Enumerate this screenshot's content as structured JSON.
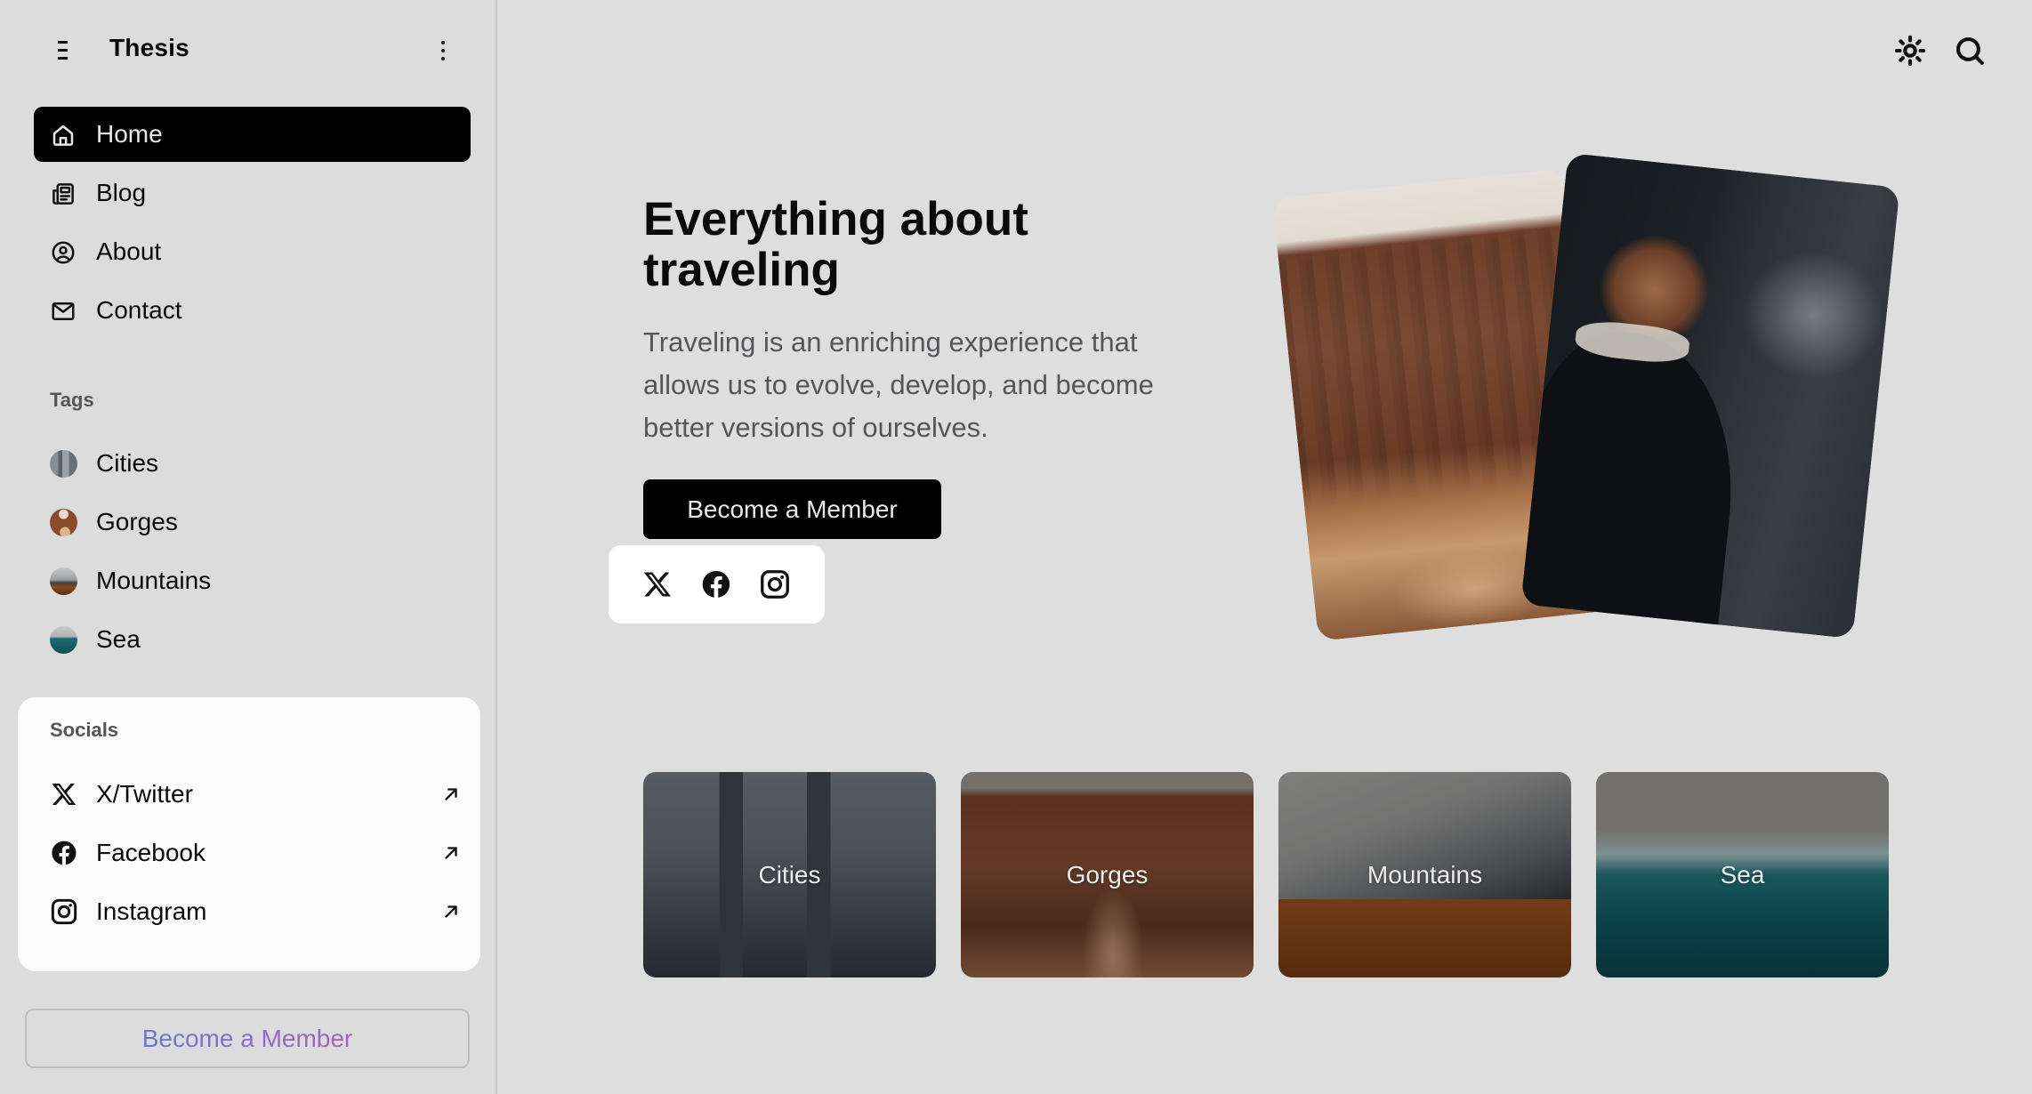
{
  "app": {
    "title": "Thesis",
    "menu_icon": "hamburger-icon",
    "more_icon": "kebab-menu-icon"
  },
  "sidebar": {
    "nav": [
      {
        "label": "Home",
        "icon": "home-icon",
        "active": true
      },
      {
        "label": "Blog",
        "icon": "newspaper-icon",
        "active": false
      },
      {
        "label": "About",
        "icon": "user-circle-icon",
        "active": false
      },
      {
        "label": "Contact",
        "icon": "mail-icon",
        "active": false
      }
    ],
    "tags_label": "Tags",
    "tags": [
      {
        "label": "Cities",
        "thumb": "cities-thumbnail"
      },
      {
        "label": "Gorges",
        "thumb": "gorges-thumbnail"
      },
      {
        "label": "Mountains",
        "thumb": "mountains-thumbnail"
      },
      {
        "label": "Sea",
        "thumb": "sea-thumbnail"
      }
    ],
    "socials_label": "Socials",
    "socials": [
      {
        "label": "X/Twitter",
        "icon": "x-twitter-icon",
        "action_icon": "external-link-arrow-icon"
      },
      {
        "label": "Facebook",
        "icon": "facebook-icon",
        "action_icon": "external-link-arrow-icon"
      },
      {
        "label": "Instagram",
        "icon": "instagram-icon",
        "action_icon": "external-link-arrow-icon"
      }
    ],
    "member_button": "Become a Member",
    "member_button_gradient": [
      "#6b78cf",
      "#a662c0"
    ]
  },
  "topbar": {
    "theme_toggle_icon": "sun-icon",
    "search_icon": "search-icon"
  },
  "hero": {
    "title": "Everything about traveling",
    "text": "Traveling is an enriching experience that allows us to evolve, develop, and become better versions of ourselves.",
    "cta": "Become a Member",
    "social_icons": [
      "x-twitter-icon",
      "facebook-icon",
      "instagram-icon"
    ],
    "images": [
      "canyon-hiker-photo",
      "bearded-man-waterfall-photo"
    ]
  },
  "tag_cards": [
    {
      "label": "Cities"
    },
    {
      "label": "Gorges"
    },
    {
      "label": "Mountains"
    },
    {
      "label": "Sea"
    }
  ],
  "colors": {
    "background": "#dedede",
    "active_nav": "#000000",
    "card": "#fcfcfc",
    "muted_text": "#56565a"
  }
}
